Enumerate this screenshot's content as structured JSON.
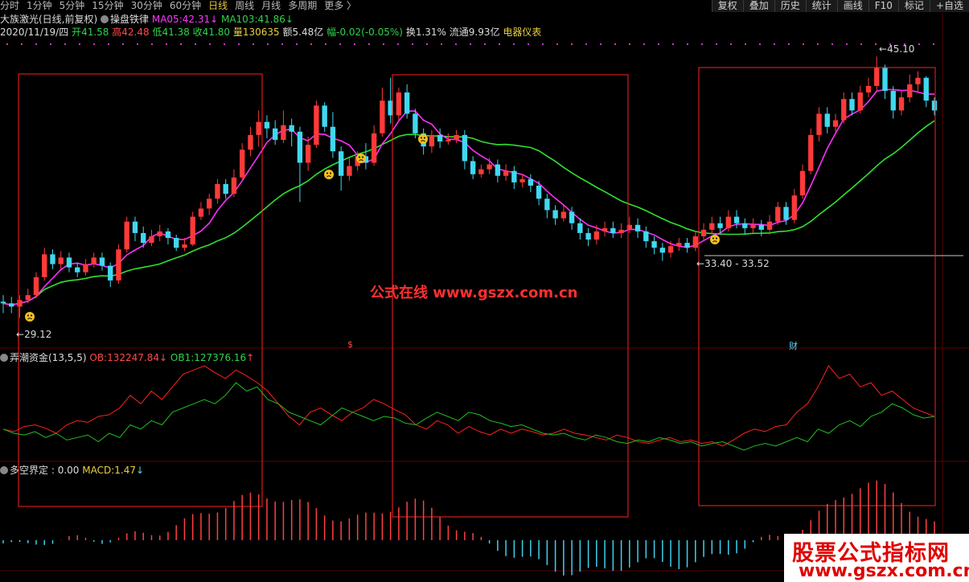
{
  "toolbar": {
    "periods": [
      "分时",
      "1分钟",
      "5分钟",
      "15分钟",
      "30分钟",
      "60分钟",
      "日线",
      "周线",
      "月线",
      "多周期",
      "更多"
    ],
    "active_period": "日线",
    "right_buttons": [
      "复权",
      "叠加",
      "历史",
      "统计",
      "画线",
      "F10",
      "标记"
    ],
    "corner": "+自选"
  },
  "info_line1": {
    "stock_name": "大族激光(日线,前复权)",
    "indicator_name": "操盘铁律",
    "ma05_label": "MA05:",
    "ma05_value": "42.31",
    "ma05_arrow": "↓",
    "ma103_label": "MA103:",
    "ma103_value": "41.86",
    "ma103_arrow": "↓"
  },
  "info_line2": {
    "date": "2020/11/19/四",
    "open_label": "开",
    "open": "41.58",
    "high_label": "高",
    "high": "42.48",
    "low_label": "低",
    "low": "41.38",
    "close_label": "收",
    "close": "41.80",
    "vol_label": "量",
    "vol": "130635",
    "amount_label": "额",
    "amount": "5.48亿",
    "change_label": "幅",
    "change": "-0.02(-0.05%)",
    "turnover_label": "换",
    "turnover": "1.31%",
    "float_label": "流通",
    "float": "9.93亿",
    "sector": "电器仪表"
  },
  "panel2": {
    "name": "弄潮资金(13,5,5)",
    "ob_label": "OB:",
    "ob_value": "132247.84",
    "ob_arrow": "↓",
    "ob1_label": "OB1:",
    "ob1_value": "127376.16",
    "ob1_arrow": "↑"
  },
  "panel3": {
    "name": "多空界定",
    "zero_value": ": 0.00",
    "macd_label": "MACD:",
    "macd_value": "1.47",
    "macd_arrow": "↓"
  },
  "annotations": {
    "low1": "29.12",
    "high1": "45.10",
    "range": "33.40 - 33.52",
    "marker_s": "$",
    "marker_cai": "财"
  },
  "watermark": "公式在线  www.gszx.com.cn",
  "logo": {
    "line1": "股票公式指标网",
    "line2": "www.gszx.com.cn"
  },
  "colors": {
    "up": "#ff3a3a",
    "down": "#40d8f0",
    "ma5": "#ff30ff",
    "ma103": "#30e030",
    "box": "#ff2020",
    "ob": "#ff2020",
    "ob1": "#20c020",
    "macd_pos": "#ff4040",
    "macd_neg": "#40d0f0"
  },
  "chart_data": {
    "type": "candlestick",
    "ylim": [
      28,
      46
    ],
    "candles": [
      [
        30.1,
        30.0,
        30.5,
        29.4
      ],
      [
        30.0,
        29.8,
        30.4,
        29.4
      ],
      [
        29.8,
        30.2,
        30.5,
        29.1
      ],
      [
        30.2,
        30.5,
        30.9,
        30.0
      ],
      [
        30.5,
        31.6,
        31.9,
        30.3
      ],
      [
        31.6,
        33.0,
        33.4,
        31.4
      ],
      [
        33.0,
        32.4,
        33.3,
        32.1
      ],
      [
        32.4,
        32.8,
        33.2,
        32.1
      ],
      [
        32.8,
        32.2,
        33.1,
        31.9
      ],
      [
        32.2,
        31.9,
        32.5,
        31.6
      ],
      [
        31.9,
        32.4,
        32.7,
        31.7
      ],
      [
        32.4,
        32.8,
        33.1,
        32.2
      ],
      [
        32.8,
        32.3,
        33.1,
        32.0
      ],
      [
        32.3,
        31.4,
        32.5,
        31.0
      ],
      [
        31.4,
        33.3,
        33.6,
        31.2
      ],
      [
        33.3,
        35.0,
        35.3,
        33.1
      ],
      [
        35.0,
        34.3,
        35.3,
        33.8
      ],
      [
        34.3,
        33.7,
        34.7,
        33.4
      ],
      [
        33.7,
        34.1,
        34.5,
        33.5
      ],
      [
        34.1,
        34.4,
        34.8,
        33.8
      ],
      [
        34.4,
        34.0,
        34.6,
        33.6
      ],
      [
        34.0,
        33.4,
        34.2,
        33.2
      ],
      [
        33.4,
        33.6,
        34.0,
        33.2
      ],
      [
        33.6,
        35.3,
        35.6,
        33.5
      ],
      [
        35.3,
        35.8,
        36.2,
        35.1
      ],
      [
        35.8,
        36.4,
        36.7,
        35.4
      ],
      [
        36.4,
        37.3,
        37.6,
        36.1
      ],
      [
        37.3,
        36.7,
        37.6,
        36.4
      ],
      [
        36.7,
        37.7,
        38.2,
        36.5
      ],
      [
        37.7,
        39.4,
        39.8,
        37.5
      ],
      [
        39.4,
        40.3,
        40.8,
        39.0
      ],
      [
        40.3,
        41.1,
        41.8,
        39.6
      ],
      [
        41.1,
        40.7,
        41.5,
        40.1
      ],
      [
        40.7,
        40.0,
        41.2,
        39.7
      ],
      [
        40.0,
        40.9,
        41.8,
        39.8
      ],
      [
        40.9,
        40.5,
        41.3,
        39.6
      ],
      [
        40.5,
        38.6,
        40.8,
        36.2
      ],
      [
        38.6,
        39.7,
        40.2,
        38.1
      ],
      [
        39.7,
        42.1,
        42.4,
        39.5
      ],
      [
        42.1,
        40.8,
        42.3,
        40.5
      ],
      [
        40.8,
        39.3,
        41.7,
        38.9
      ],
      [
        39.3,
        37.8,
        39.6,
        36.9
      ],
      [
        37.8,
        38.4,
        38.9,
        37.5
      ],
      [
        38.4,
        39.0,
        39.3,
        38.1
      ],
      [
        39.0,
        38.6,
        39.8,
        38.2
      ],
      [
        38.6,
        40.4,
        40.9,
        38.4
      ],
      [
        40.4,
        42.4,
        43.2,
        40.2
      ],
      [
        42.4,
        41.5,
        43.8,
        41.0
      ],
      [
        41.5,
        42.9,
        43.2,
        41.2
      ],
      [
        42.9,
        41.6,
        43.4,
        41.3
      ],
      [
        41.6,
        40.4,
        41.9,
        40.1
      ],
      [
        40.4,
        39.6,
        40.7,
        39.1
      ],
      [
        39.6,
        40.3,
        40.6,
        39.2
      ],
      [
        40.3,
        39.9,
        40.7,
        39.5
      ],
      [
        39.9,
        40.0,
        40.4,
        39.7
      ],
      [
        40.0,
        40.3,
        40.6,
        39.8
      ],
      [
        40.3,
        38.7,
        40.6,
        38.2
      ],
      [
        38.7,
        37.9,
        39.0,
        37.6
      ],
      [
        37.9,
        38.2,
        38.5,
        37.7
      ],
      [
        38.2,
        38.5,
        38.9,
        37.9
      ],
      [
        38.5,
        37.8,
        38.8,
        37.4
      ],
      [
        37.8,
        38.1,
        38.5,
        37.5
      ],
      [
        38.1,
        37.4,
        38.4,
        37.0
      ],
      [
        37.4,
        37.6,
        37.9,
        37.1
      ],
      [
        37.6,
        37.2,
        37.9,
        36.8
      ],
      [
        37.2,
        36.4,
        37.5,
        36.0
      ],
      [
        36.4,
        35.7,
        36.7,
        35.2
      ],
      [
        35.7,
        35.2,
        36.0,
        34.8
      ],
      [
        35.2,
        35.6,
        36.0,
        35.0
      ],
      [
        35.6,
        34.9,
        35.9,
        34.5
      ],
      [
        34.9,
        34.3,
        35.2,
        33.9
      ],
      [
        34.3,
        33.9,
        34.6,
        33.5
      ],
      [
        33.9,
        34.4,
        34.8,
        33.6
      ],
      [
        34.4,
        34.6,
        35.0,
        34.1
      ],
      [
        34.6,
        34.3,
        35.0,
        34.0
      ],
      [
        34.3,
        34.5,
        34.9,
        34.0
      ],
      [
        34.5,
        34.8,
        35.3,
        34.3
      ],
      [
        34.8,
        34.4,
        35.2,
        34.0
      ],
      [
        34.4,
        33.8,
        34.7,
        33.4
      ],
      [
        33.8,
        33.4,
        34.1,
        33.0
      ],
      [
        33.4,
        33.1,
        33.7,
        32.6
      ],
      [
        33.1,
        33.5,
        33.8,
        32.8
      ],
      [
        33.5,
        33.7,
        34.0,
        33.2
      ],
      [
        33.7,
        33.4,
        34.0,
        33.1
      ],
      [
        33.4,
        34.1,
        34.4,
        33.2
      ],
      [
        34.1,
        34.5,
        34.9,
        33.9
      ],
      [
        34.5,
        34.9,
        35.3,
        34.3
      ],
      [
        34.9,
        34.6,
        35.3,
        34.3
      ],
      [
        34.6,
        35.3,
        35.7,
        34.4
      ],
      [
        35.3,
        34.9,
        35.7,
        34.6
      ],
      [
        34.9,
        34.6,
        35.2,
        34.2
      ],
      [
        34.6,
        34.8,
        35.2,
        34.3
      ],
      [
        34.8,
        34.5,
        35.1,
        34.1
      ],
      [
        34.5,
        35.0,
        35.4,
        34.2
      ],
      [
        35.0,
        35.9,
        36.2,
        34.8
      ],
      [
        35.9,
        35.1,
        36.2,
        34.8
      ],
      [
        35.1,
        36.6,
        37.0,
        34.9
      ],
      [
        36.6,
        38.1,
        38.5,
        36.4
      ],
      [
        38.1,
        40.3,
        40.7,
        37.9
      ],
      [
        40.3,
        41.6,
        42.0,
        39.9
      ],
      [
        41.6,
        40.8,
        42.0,
        40.4
      ],
      [
        40.8,
        41.2,
        41.6,
        40.5
      ],
      [
        41.2,
        42.5,
        42.9,
        41.0
      ],
      [
        42.5,
        41.8,
        42.9,
        41.5
      ],
      [
        41.8,
        42.9,
        43.3,
        41.6
      ],
      [
        42.9,
        43.3,
        43.8,
        42.6
      ],
      [
        43.3,
        44.4,
        45.1,
        43.0
      ],
      [
        44.4,
        43.0,
        44.6,
        42.5
      ],
      [
        43.0,
        41.8,
        43.3,
        41.3
      ],
      [
        41.8,
        42.6,
        43.0,
        41.5
      ],
      [
        42.6,
        43.4,
        44.0,
        42.3
      ],
      [
        43.4,
        43.8,
        44.2,
        42.9
      ],
      [
        43.8,
        42.4,
        43.9,
        42.0
      ],
      [
        42.4,
        41.8,
        42.6,
        41.5
      ]
    ]
  }
}
